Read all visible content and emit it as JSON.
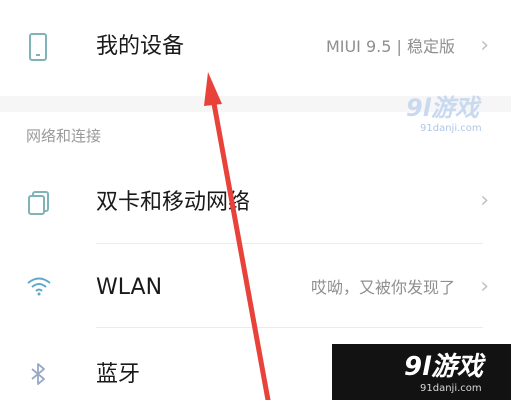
{
  "device_row": {
    "label": "我的设备",
    "value": "MIUI 9.5 | 稳定版",
    "chevron": "›"
  },
  "section": {
    "header": "网络和连接"
  },
  "network_rows": [
    {
      "label": "双卡和移动网络",
      "value": "",
      "chevron": "›",
      "icon": "dual-sim-icon"
    },
    {
      "label": "WLAN",
      "value": "哎呦，又被你发现了",
      "chevron": "›",
      "icon": "wifi-icon"
    },
    {
      "label": "蓝牙",
      "value": "",
      "chevron": "",
      "icon": "bluetooth-icon"
    }
  ],
  "watermark_top": {
    "logo": "9l游戏",
    "site": "91danji.com"
  },
  "watermark_bottom": {
    "logo": "9l游戏",
    "site": "91danji.com"
  },
  "colors": {
    "icon": "#7fb3b8",
    "wifi": "#5da8cc",
    "arrow": "#e8423a"
  }
}
